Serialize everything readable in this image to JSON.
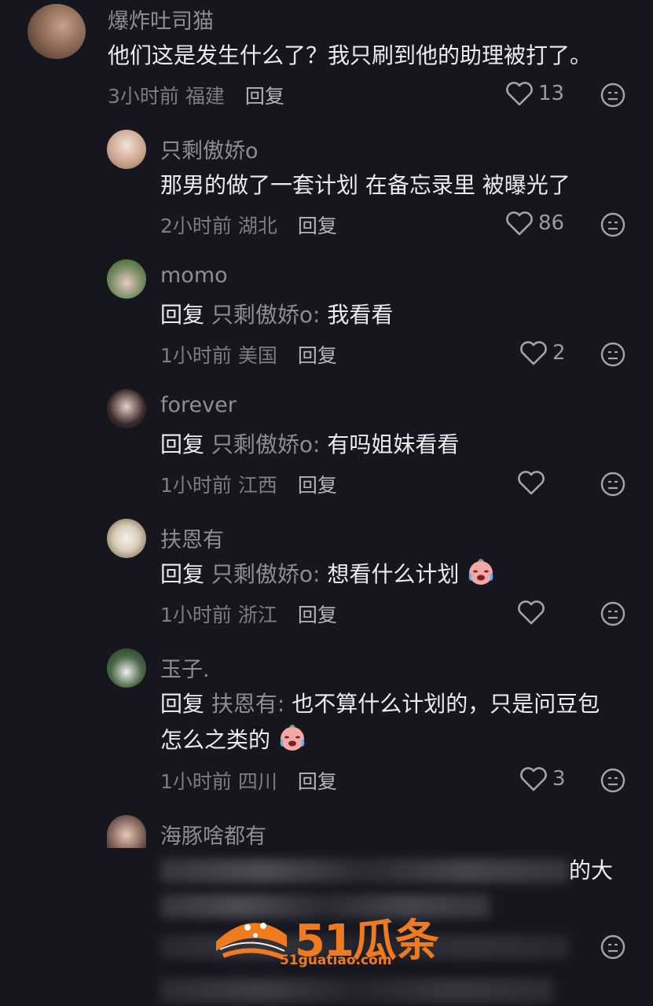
{
  "comments": [
    {
      "name": "爆炸吐司猫",
      "text": "他们这是发生什么了？我只刷到他的助理被打了。",
      "time": "3小时前",
      "region": "福建",
      "reply": "回复",
      "likes": "13"
    },
    {
      "name": "只剩傲娇o",
      "text": "那男的做了一套计划 在备忘录里 被曝光了",
      "time": "2小时前",
      "region": "湖北",
      "reply": "回复",
      "likes": "86"
    },
    {
      "name": "momo",
      "prefix": "回复",
      "target": "只剩傲娇o:",
      "text": "我看看",
      "time": "1小时前",
      "region": "美国",
      "reply": "回复",
      "likes": "2"
    },
    {
      "name": "forever",
      "prefix": "回复",
      "target": "只剩傲娇o:",
      "text": "有吗姐妹看看",
      "time": "1小时前",
      "region": "江西",
      "reply": "回复",
      "likes": ""
    },
    {
      "name": "扶恩有",
      "prefix": "回复",
      "target": "只剩傲娇o:",
      "text": "想看什么计划",
      "time": "1小时前",
      "region": "浙江",
      "reply": "回复",
      "likes": ""
    },
    {
      "name": "玉子.",
      "prefix": "回复",
      "target": "扶恩有:",
      "text": "也不算什么计划的，只是问豆包",
      "text2": "怎么之类的",
      "time": "1小时前",
      "region": "四川",
      "reply": "回复",
      "likes": "3"
    },
    {
      "name": "海豚啥都有",
      "text_visible": "的大"
    }
  ],
  "watermark": {
    "brand": "51瓜条",
    "url": "51guatiao.com",
    "color": "#f07a1e"
  },
  "icons": {
    "like": "heart-outline-icon",
    "dislike": "neutral-face-icon",
    "emoji": "crying-face-emoji"
  }
}
